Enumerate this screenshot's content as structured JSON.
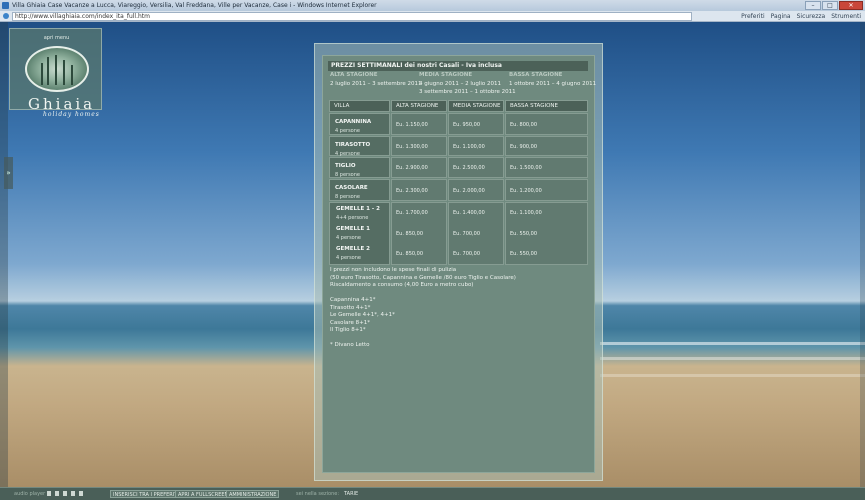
{
  "window": {
    "title": "Villa Ghiaia Case Vacanze a Lucca, Viareggio, Versilia, Val Freddana, Ville per Vacanze, Case i - Windows Internet Explorer",
    "url": "http://www.villaghiaia.com/index_ita_full.htm",
    "toolbar_items": [
      "Preferiti",
      "Pagina",
      "Sicurezza",
      "Strumenti"
    ],
    "buttons": {
      "minimize": "–",
      "maximize": "□",
      "close": "✕"
    }
  },
  "logo": {
    "menu_label": "apri menu",
    "name": "Ghiaia",
    "subtitle": "holiday homes",
    "icon": "villa-oval-icon"
  },
  "sidebar": {
    "toggle_label": "»"
  },
  "prices": {
    "title": "PREZZI SETTIMANALI dei nostri Casali - Iva inclusa",
    "seasons": [
      {
        "name": "ALTA STAGIONE",
        "dates": [
          "2 luglio 2011 – 3 settembre 2011"
        ]
      },
      {
        "name": "MEDIA STAGIONE",
        "dates": [
          "4 giugno 2011 – 2 luglio 2011",
          "3 settembre 2011 – 1 ottobre 2011"
        ]
      },
      {
        "name": "BASSA STAGIONE",
        "dates": [
          "1 ottobre 2011 – 4 giugno 2011"
        ]
      }
    ],
    "columns": [
      "VILLA",
      "ALTA STAGIONE",
      "MEDIA STAGIONE",
      "BASSA STAGIONE"
    ],
    "rows": [
      {
        "name": "CAPANNINA",
        "people": "4 persone",
        "alta": "Eu. 1.150,00",
        "media": "Eu. 950,00",
        "bassa": "Eu. 800,00"
      },
      {
        "name": "TIRASOTTO",
        "people": "4 persone",
        "alta": "Eu. 1.300,00",
        "media": "Eu. 1.100,00",
        "bassa": "Eu. 900,00"
      },
      {
        "name": "TIGLIO",
        "people": "8 persone",
        "alta": "Eu. 2.900,00",
        "media": "Eu. 2.500,00",
        "bassa": "Eu. 1.500,00"
      },
      {
        "name": "CASOLARE",
        "people": "8 persone",
        "alta": "Eu. 2.300,00",
        "media": "Eu. 2.000,00",
        "bassa": "Eu. 1.200,00"
      }
    ],
    "gemelle": {
      "items": [
        {
          "name": "GEMELLE 1 - 2",
          "people": "4+4 persone",
          "alta": "Eu. 1.700,00",
          "media": "Eu. 1.400,00",
          "bassa": "Eu. 1.100,00"
        },
        {
          "name": "GEMELLE 1",
          "people": "4 persone",
          "alta": "Eu. 850,00",
          "media": "Eu. 700,00",
          "bassa": "Eu. 550,00"
        },
        {
          "name": "GEMELLE 2",
          "people": "4 persone",
          "alta": "Eu. 850,00",
          "media": "Eu. 700,00",
          "bassa": "Eu. 550,00"
        }
      ]
    },
    "notes": [
      "I prezzi non includono le spese finali di pulizia",
      "(50 euro Tirasotto, Capannina e Gemelle /80 euro Tiglio e Casolare)",
      "Riscaldamento a consumo (4,00 Euro a metro cubo)",
      "",
      "Capannina 4+1*",
      "Tirasotto 4+1*",
      "Le Gemelle 4+1*, 4+1*",
      "Casolare 8+1*",
      "Il Tiglio 8+1*",
      "",
      "* Divano Letto"
    ]
  },
  "bottombar": {
    "audio_label": "audio player",
    "controls": [
      "play-icon",
      "pause-icon",
      "stop-icon",
      "prev-icon",
      "next-icon"
    ],
    "buttons": [
      "INSERISCI TRA I PREFERITI",
      "APRI A FULLSCREEN",
      "AMMINISTRAZIONE"
    ],
    "section_label": "sei nella sezione:",
    "section_value": "TARIE"
  },
  "colors": {
    "panel": "#6f8a7f",
    "header": "#4c6158",
    "villa_cell": "#556d63",
    "price_cell": "#617a70"
  }
}
